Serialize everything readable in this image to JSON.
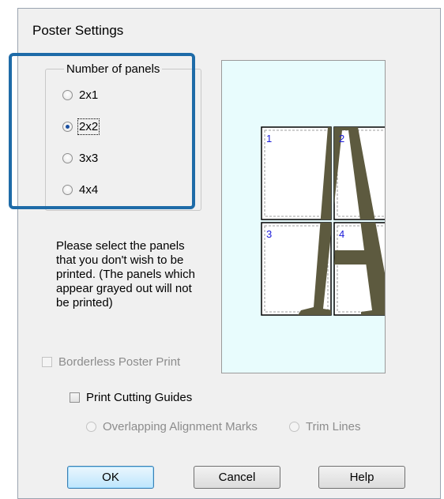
{
  "dialog": {
    "title": "Poster Settings"
  },
  "panels_group": {
    "legend": "Number of panels",
    "options": [
      {
        "label": "2x1",
        "checked": false
      },
      {
        "label": "2x2",
        "checked": true
      },
      {
        "label": "3x3",
        "checked": false
      },
      {
        "label": "4x4",
        "checked": false
      }
    ]
  },
  "instructions": "Please select the panels\nthat you don't wish to be\nprinted. (The panels which\nappear grayed out will not\nbe printed)",
  "preview": {
    "panel_numbers": [
      "1",
      "2",
      "3",
      "4"
    ],
    "glyph": "A",
    "glyph_color": "#5d5a3f",
    "number_color": "#1a1ad8",
    "background_color": "#e8fcfd"
  },
  "borderless": {
    "label": "Borderless Poster Print",
    "checked": false,
    "enabled": false
  },
  "cutting_guides": {
    "label": "Print Cutting Guides",
    "checked": false,
    "options": [
      {
        "label": "Overlapping Alignment Marks",
        "enabled": false
      },
      {
        "label": "Trim Lines",
        "enabled": false
      }
    ]
  },
  "buttons": {
    "ok": "OK",
    "cancel": "Cancel",
    "help": "Help"
  },
  "highlight_color": "#1e6ba8"
}
